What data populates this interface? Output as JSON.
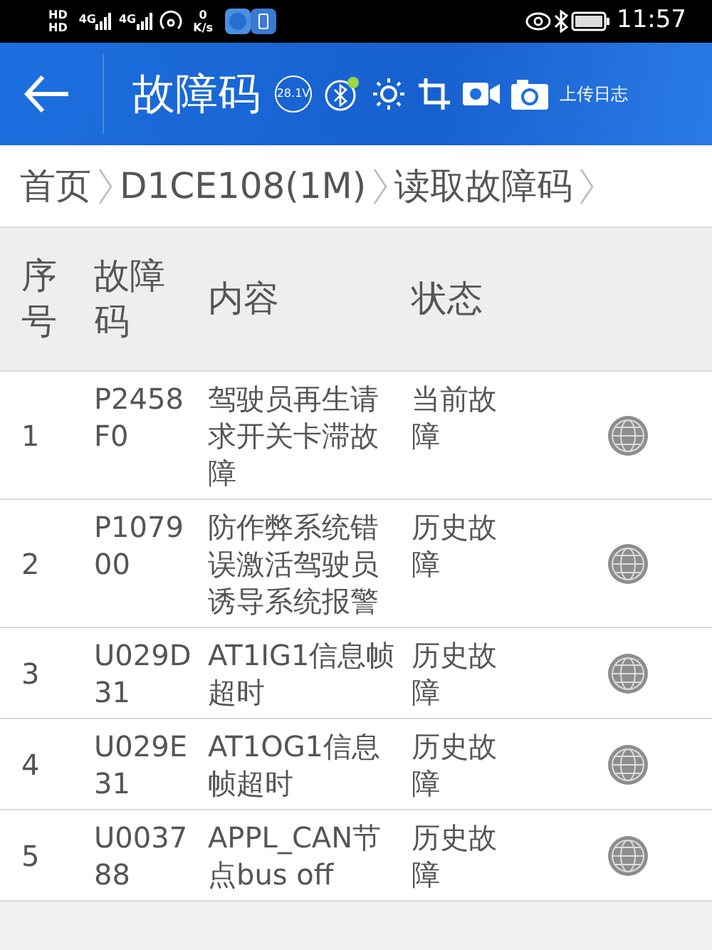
{
  "status_bar": {
    "sim_labels": [
      "HD",
      "HD"
    ],
    "network_labels": [
      "4G",
      "4G"
    ],
    "speed_value": "0",
    "speed_unit": "K/s",
    "time": "11:57"
  },
  "header": {
    "title": "故障码",
    "voltage": "28.1V",
    "bluetooth_connected": true,
    "upload_label": "上传日志"
  },
  "breadcrumb": [
    "首页",
    "D1CE108(1M)",
    "读取故障码"
  ],
  "table": {
    "columns": [
      "序号",
      "故障码",
      "内容",
      "状态"
    ],
    "rows": [
      {
        "index": "1",
        "code": "P2458F0",
        "content": "驾驶员再生请求开关卡滞故障",
        "status": "当前故障"
      },
      {
        "index": "2",
        "code": "P107900",
        "content": "防作弊系统错误激活驾驶员诱导系统报警",
        "status": "历史故障"
      },
      {
        "index": "3",
        "code": "U029D31",
        "content": "AT1IG1信息帧超时",
        "status": "历史故障"
      },
      {
        "index": "4",
        "code": "U029E31",
        "content": "AT1OG1信息帧超时",
        "status": "历史故障"
      },
      {
        "index": "5",
        "code": "U003788",
        "content": "APPL_CAN节点bus off",
        "status": "历史故障"
      }
    ]
  }
}
